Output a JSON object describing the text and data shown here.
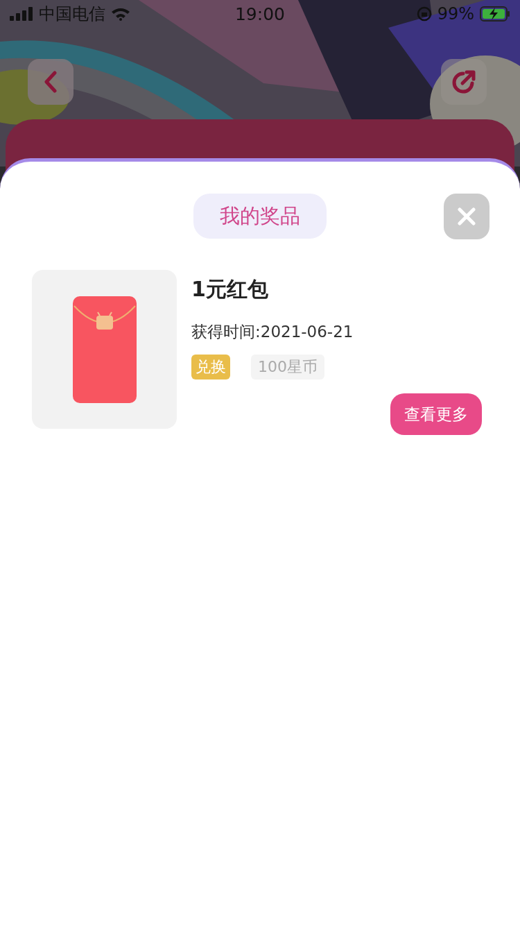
{
  "status_bar": {
    "carrier": "中国电信",
    "time": "19:00",
    "battery": "99%"
  },
  "modal": {
    "title": "我的奖品",
    "prizes": [
      {
        "name": "1元红包",
        "obtained": "获得时间:2021-06-21",
        "tags": [
          {
            "label": "兑换",
            "kind": "action"
          },
          {
            "label": "100星币",
            "kind": "price"
          }
        ],
        "button": "查看更多"
      }
    ]
  }
}
